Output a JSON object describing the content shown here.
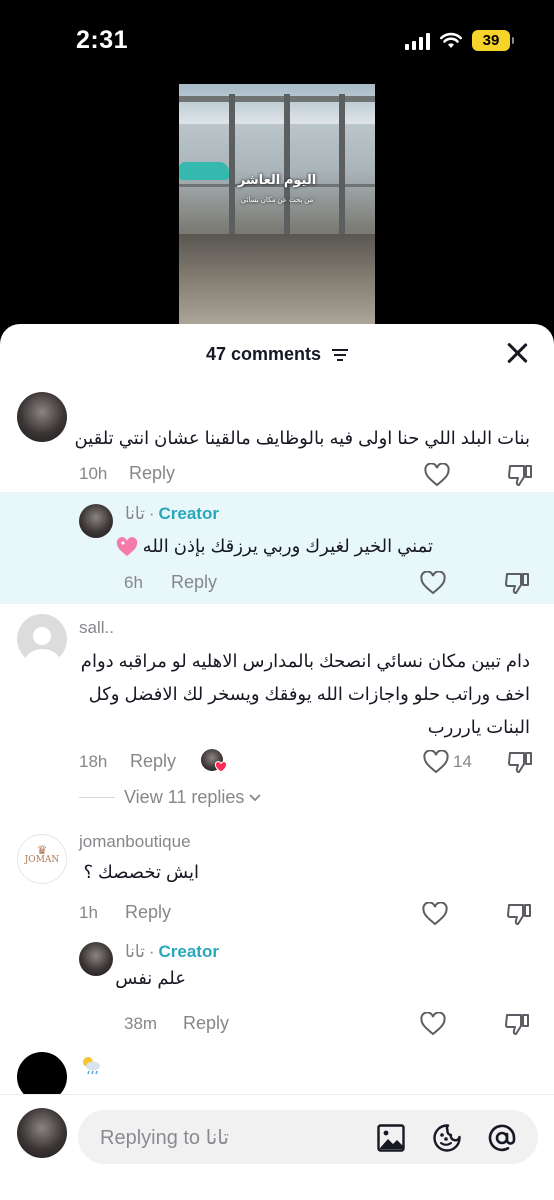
{
  "status_bar": {
    "time": "2:31",
    "battery": "39"
  },
  "video": {
    "caption_title": "اليوم العاشر",
    "caption_sub": "من بحث عن مكان نسائي"
  },
  "header": {
    "comments_count": "47 comments"
  },
  "reply_label": "Reply",
  "creator_label": "Creator",
  "comments": [
    {
      "username": "",
      "text": "بنات البلد اللي حنا اولى فيه بالوظايف مالقينا عشان انتي تلقين",
      "time": "10h",
      "likes": ""
    },
    {
      "username": "تانا",
      "text": "تمني الخير لغيرك وربي يرزقك بإذن الله",
      "time": "6h",
      "likes": ""
    },
    {
      "username": "sall..",
      "text": "دام تبين مكان نسائي انصحك بالمدارس الاهليه لو مراقبه دوام اخف وراتب حلو واجازات الله يوفقك ويسخر لك الافضل وكل البنات يارررب",
      "time": "18h",
      "likes": "14",
      "view_replies": "View 11 replies"
    },
    {
      "username": "jomanboutique",
      "text": "ايش تخصصك ؟",
      "time": "1h",
      "likes": ""
    },
    {
      "username": "تانا",
      "text": "علم نفس",
      "time": "38m",
      "likes": ""
    },
    {
      "username": "",
      "text": "",
      "time": "",
      "likes": ""
    }
  ],
  "avatar_logo": "JOMAN",
  "input": {
    "placeholder": "Replying to تانا"
  }
}
